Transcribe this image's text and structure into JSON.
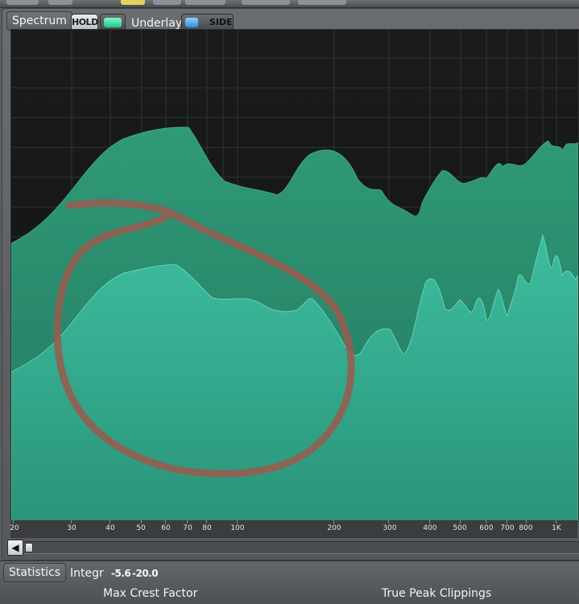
{
  "spectrum": {
    "tab_label": "Spectrum",
    "hold_label": "HOLD",
    "underlay_label": "Underlay",
    "side_label": "SIDE",
    "hold_led_color": "#2fe0a0",
    "side_led_color": "#3ba0ef"
  },
  "freq_axis": {
    "ticks": [
      "20",
      "30",
      "40",
      "50",
      "60",
      "70",
      "80",
      "100",
      "200",
      "300",
      "400",
      "500",
      "600",
      "700",
      "800",
      "1K"
    ]
  },
  "scrollbar": {
    "left_arrow_icon": "arrow-left-icon"
  },
  "statistics": {
    "tab_label": "Statistics",
    "integr_label": "Integr",
    "integr_values": [
      "-5.6",
      "-20.0"
    ],
    "max_crest_label": "Max Crest Factor",
    "true_peak_label": "True Peak Clippings"
  },
  "colors": {
    "mid_fill": "#2a8f70",
    "side_fill": "#33b096",
    "annotation_stroke": "#9a5a4e",
    "graph_bg": "#141516"
  }
}
